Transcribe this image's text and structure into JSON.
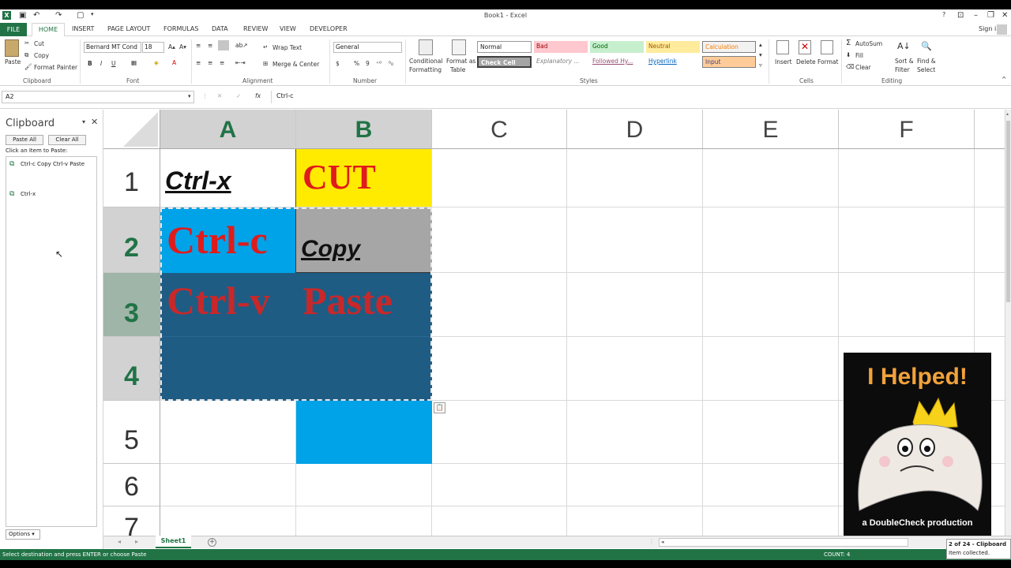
{
  "window": {
    "title": "Book1 - Excel",
    "help": "?",
    "signin": "Sign in"
  },
  "tabs": {
    "file": "FILE",
    "home": "HOME",
    "items": [
      "INSERT",
      "PAGE LAYOUT",
      "FORMULAS",
      "DATA",
      "REVIEW",
      "VIEW",
      "DEVELOPER"
    ]
  },
  "ribbon": {
    "clipboard": {
      "paste": "Paste",
      "cut": "Cut",
      "copy": "Copy",
      "format_painter": "Format Painter",
      "label": "Clipboard"
    },
    "font": {
      "name": "Bernard MT Cond",
      "size": "18",
      "bold": "B",
      "italic": "I",
      "underline": "U",
      "label": "Font"
    },
    "alignment": {
      "wrap": "Wrap Text",
      "merge": "Merge & Center",
      "label": "Alignment"
    },
    "number": {
      "format": "General",
      "currency": "$",
      "percent": "%",
      "comma": "9",
      "label": "Number"
    },
    "styles": {
      "conditional": "Conditional",
      "conditional2": "Formatting",
      "format_table": "Format as",
      "format_table2": "Table",
      "cells": [
        "Normal",
        "Bad",
        "Good",
        "Neutral",
        "Calculation",
        "Check Cell",
        "Explanatory ...",
        "Followed Hy...",
        "Hyperlink",
        "Input"
      ],
      "label": "Styles"
    },
    "cells": {
      "insert": "Insert",
      "delete": "Delete",
      "format": "Format",
      "label": "Cells"
    },
    "editing": {
      "autosum": "AutoSum",
      "fill": "Fill",
      "clear": "Clear",
      "sort": "Sort &",
      "sort2": "Filter",
      "find": "Find &",
      "find2": "Select",
      "label": "Editing"
    }
  },
  "formula_bar": {
    "name_box": "A2",
    "cancel": "✕",
    "enter": "✓",
    "fx": "fx",
    "value": "Ctrl-c"
  },
  "clipboard_pane": {
    "title": "Clipboard",
    "paste_all": "Paste All",
    "clear_all": "Clear All",
    "hint": "Click an Item to Paste:",
    "items": [
      "Ctrl-c Copy Ctrl-v Paste",
      "Ctrl-x"
    ],
    "options": "Options"
  },
  "grid": {
    "columns": [
      "A",
      "B",
      "C",
      "D",
      "E",
      "F"
    ],
    "rows": [
      "1",
      "2",
      "3",
      "4",
      "5",
      "6",
      "7"
    ],
    "cells": {
      "A1": "Ctrl-x",
      "B1": "CUT",
      "A2": "Ctrl-c",
      "B2": "Copy",
      "A3": "Ctrl-v",
      "B3": "Paste"
    }
  },
  "sheet": {
    "tab": "Sheet1",
    "add": "+"
  },
  "status": {
    "message": "Select destination and press ENTER or choose Paste",
    "count": "COUNT: 4"
  },
  "notification": {
    "line1": "2 of 24 - Clipboard",
    "line2": "Item collected."
  },
  "promo": {
    "headline": "I Helped!",
    "footer": "a DoubleCheck production"
  },
  "colors": {
    "excel_green": "#217346",
    "cyan": "#00a2e8",
    "yellow": "#ffeb00",
    "gray": "#a6a6a6",
    "dark_blue": "#1e5c84",
    "red": "#e01b1b"
  }
}
